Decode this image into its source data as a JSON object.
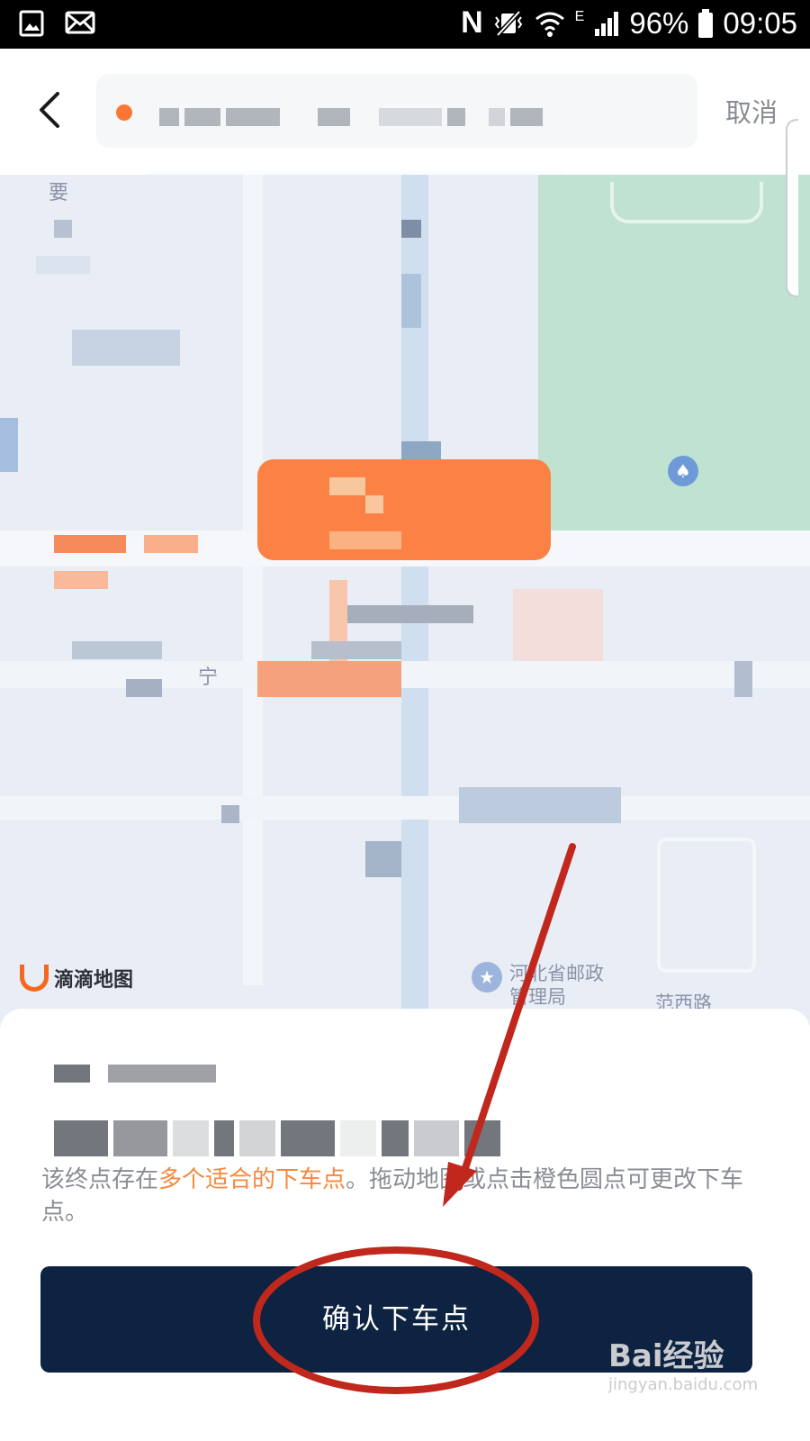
{
  "status_bar": {
    "battery": "96%",
    "time": "09:05",
    "network": "E",
    "icons": [
      "gallery-icon",
      "mail-icon",
      "nfc-icon",
      "vibrate-icon",
      "wifi-icon",
      "signal-icon",
      "battery-icon"
    ]
  },
  "header": {
    "cancel_label": "取消",
    "back_icon": "chevron-left-icon"
  },
  "map": {
    "provider_label": "滴滴地图",
    "poi_label": "河北省邮政管理局",
    "road_label": "范西路",
    "corner_label": "要",
    "mid_label": "宁"
  },
  "card": {
    "notice_prefix": "该终点存在",
    "notice_highlight": "多个适合的下车点",
    "notice_suffix": "。拖动地图或点击橙色圆点可更改下车点。",
    "confirm_label": "确认下车点"
  },
  "watermark": {
    "brand": "Bai经验",
    "url": "jingyan.baidu.com"
  },
  "colors": {
    "accent_orange": "#fc7733",
    "button_navy": "#0d2341",
    "park_green": "#bfe3d0",
    "annotation_red": "#c0271d"
  }
}
